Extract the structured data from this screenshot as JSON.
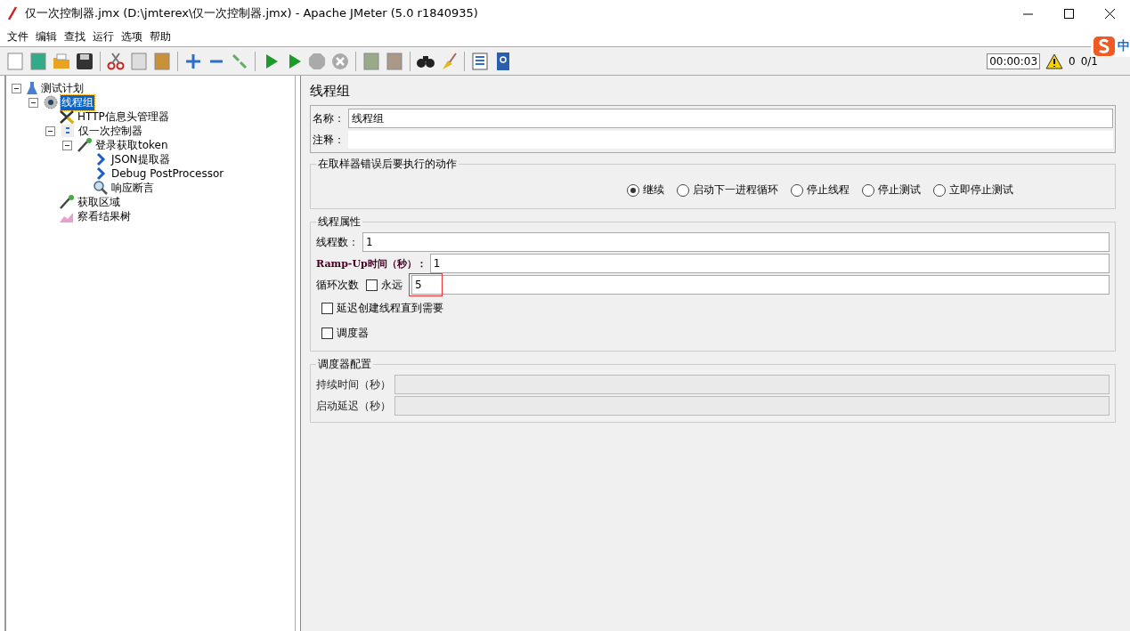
{
  "window": {
    "title": "仅一次控制器.jmx (D:\\jmterex\\仅一次控制器.jmx) - Apache JMeter (5.0 r1840935)"
  },
  "menu": [
    "文件",
    "编辑",
    "查找",
    "运行",
    "选项",
    "帮助"
  ],
  "status": {
    "timer": "00:00:03",
    "warnings": "0",
    "threads": "0/1"
  },
  "ime": {
    "label": "中"
  },
  "tree": [
    {
      "label": "测试计划",
      "kind": "flask",
      "expanded": true,
      "selected": false,
      "children": [
        {
          "label": "线程组",
          "kind": "gear",
          "expanded": true,
          "selected": true,
          "children": [
            {
              "label": "HTTP信息头管理器",
              "kind": "tools",
              "selected": false
            },
            {
              "label": "仅一次控制器",
              "kind": "controller",
              "expanded": true,
              "selected": false,
              "children": [
                {
                  "label": "登录获取token",
                  "kind": "pipette",
                  "expanded": true,
                  "selected": false,
                  "children": [
                    {
                      "label": "JSON提取器",
                      "kind": "arrow",
                      "selected": false
                    },
                    {
                      "label": "Debug PostProcessor",
                      "kind": "arrow",
                      "selected": false
                    },
                    {
                      "label": "响应断言",
                      "kind": "magnifier",
                      "selected": false
                    }
                  ]
                }
              ]
            },
            {
              "label": "获取区域",
              "kind": "pipette",
              "selected": false
            },
            {
              "label": "察看结果树",
              "kind": "chart",
              "selected": false
            }
          ]
        }
      ]
    }
  ],
  "panel": {
    "title": "线程组",
    "name_label": "名称：",
    "name_value": "线程组",
    "comment_label": "注释：",
    "error_action": {
      "legend": "在取样器错误后要执行的动作",
      "options": [
        {
          "label": "继续",
          "selected": true
        },
        {
          "label": "启动下一进程循环",
          "selected": false
        },
        {
          "label": "停止线程",
          "selected": false
        },
        {
          "label": "停止测试",
          "selected": false
        },
        {
          "label": "立即停止测试",
          "selected": false
        }
      ]
    },
    "thread_props": {
      "legend": "线程属性",
      "threads_label": "线程数：",
      "threads_value": "1",
      "rampup_label": "Ramp-Up时间（秒）：",
      "rampup_value": "1",
      "loop_label": "循环次数",
      "forever_label": "永远",
      "forever_checked": false,
      "loop_value": "5",
      "checkboxes": [
        {
          "label": "延迟创建线程直到需要",
          "checked": false
        },
        {
          "label": "调度器",
          "checked": false
        }
      ]
    },
    "scheduler": {
      "legend": "调度器配置",
      "fields": [
        {
          "label": "持续时间（秒）",
          "disabled": true
        },
        {
          "label": "启动延迟（秒）",
          "disabled": true
        }
      ]
    }
  }
}
